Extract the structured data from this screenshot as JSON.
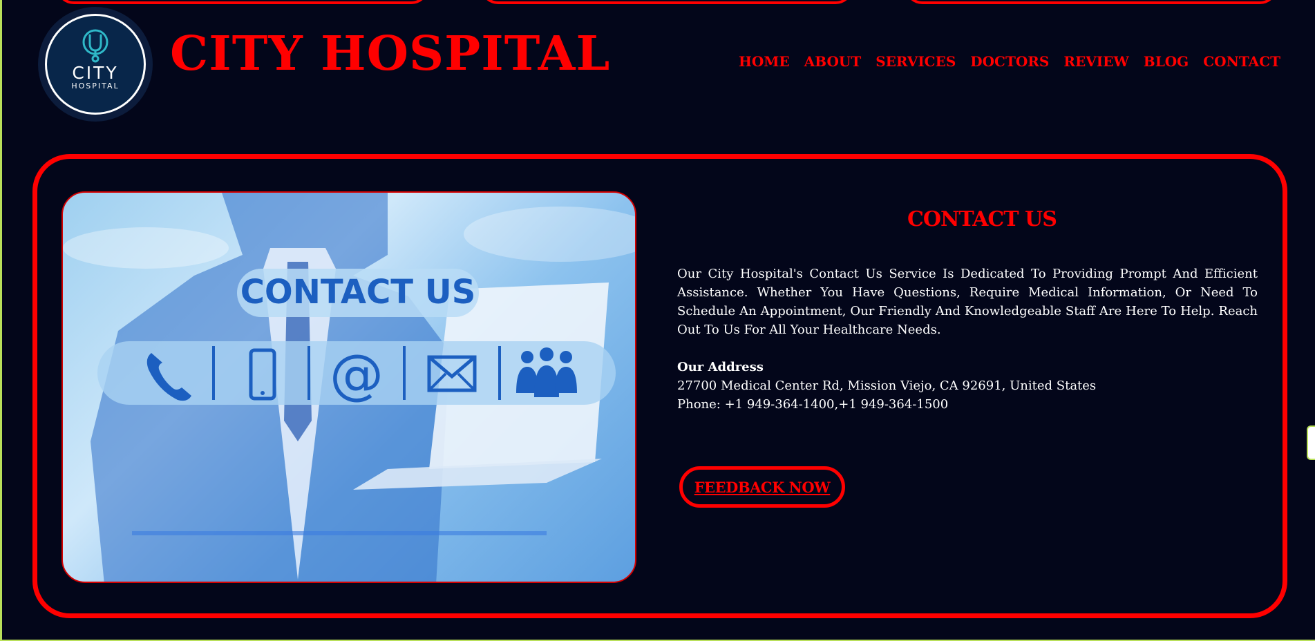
{
  "header": {
    "logo": {
      "line1": "CITY",
      "line2": "HOSPITAL",
      "icon": "stethoscope-icon"
    },
    "site_title": "CITY HOSPITAL",
    "nav": [
      "HOME",
      "ABOUT",
      "SERVICES",
      "DOCTORS",
      "REVIEW",
      "BLOG",
      "CONTACT"
    ]
  },
  "contact": {
    "image": {
      "heading": "CONTACT US",
      "icons": [
        "phone-icon",
        "mobile-icon",
        "at-sign-icon",
        "envelope-icon",
        "group-icon"
      ]
    },
    "title": "CONTACT US",
    "description": "Our City Hospital's Contact Us Service Is Dedicated To Providing Prompt And Efficient Assistance. Whether You Have Questions, Require Medical Information, Or Need To Schedule An Appointment, Our Friendly And Knowledgeable Staff Are Here To Help. Reach Out To Us For All Your Healthcare Needs.",
    "address_label": "Our Address",
    "address": "27700 Medical Center Rd, Mission Viejo, CA 92691, United States",
    "phone": "Phone: +1 949-364-1400,+1 949-364-1500",
    "feedback_button": "FEEDBACK NOW"
  },
  "colors": {
    "background": "#03061a",
    "accent": "#ff0000",
    "text": "#ffffff"
  }
}
